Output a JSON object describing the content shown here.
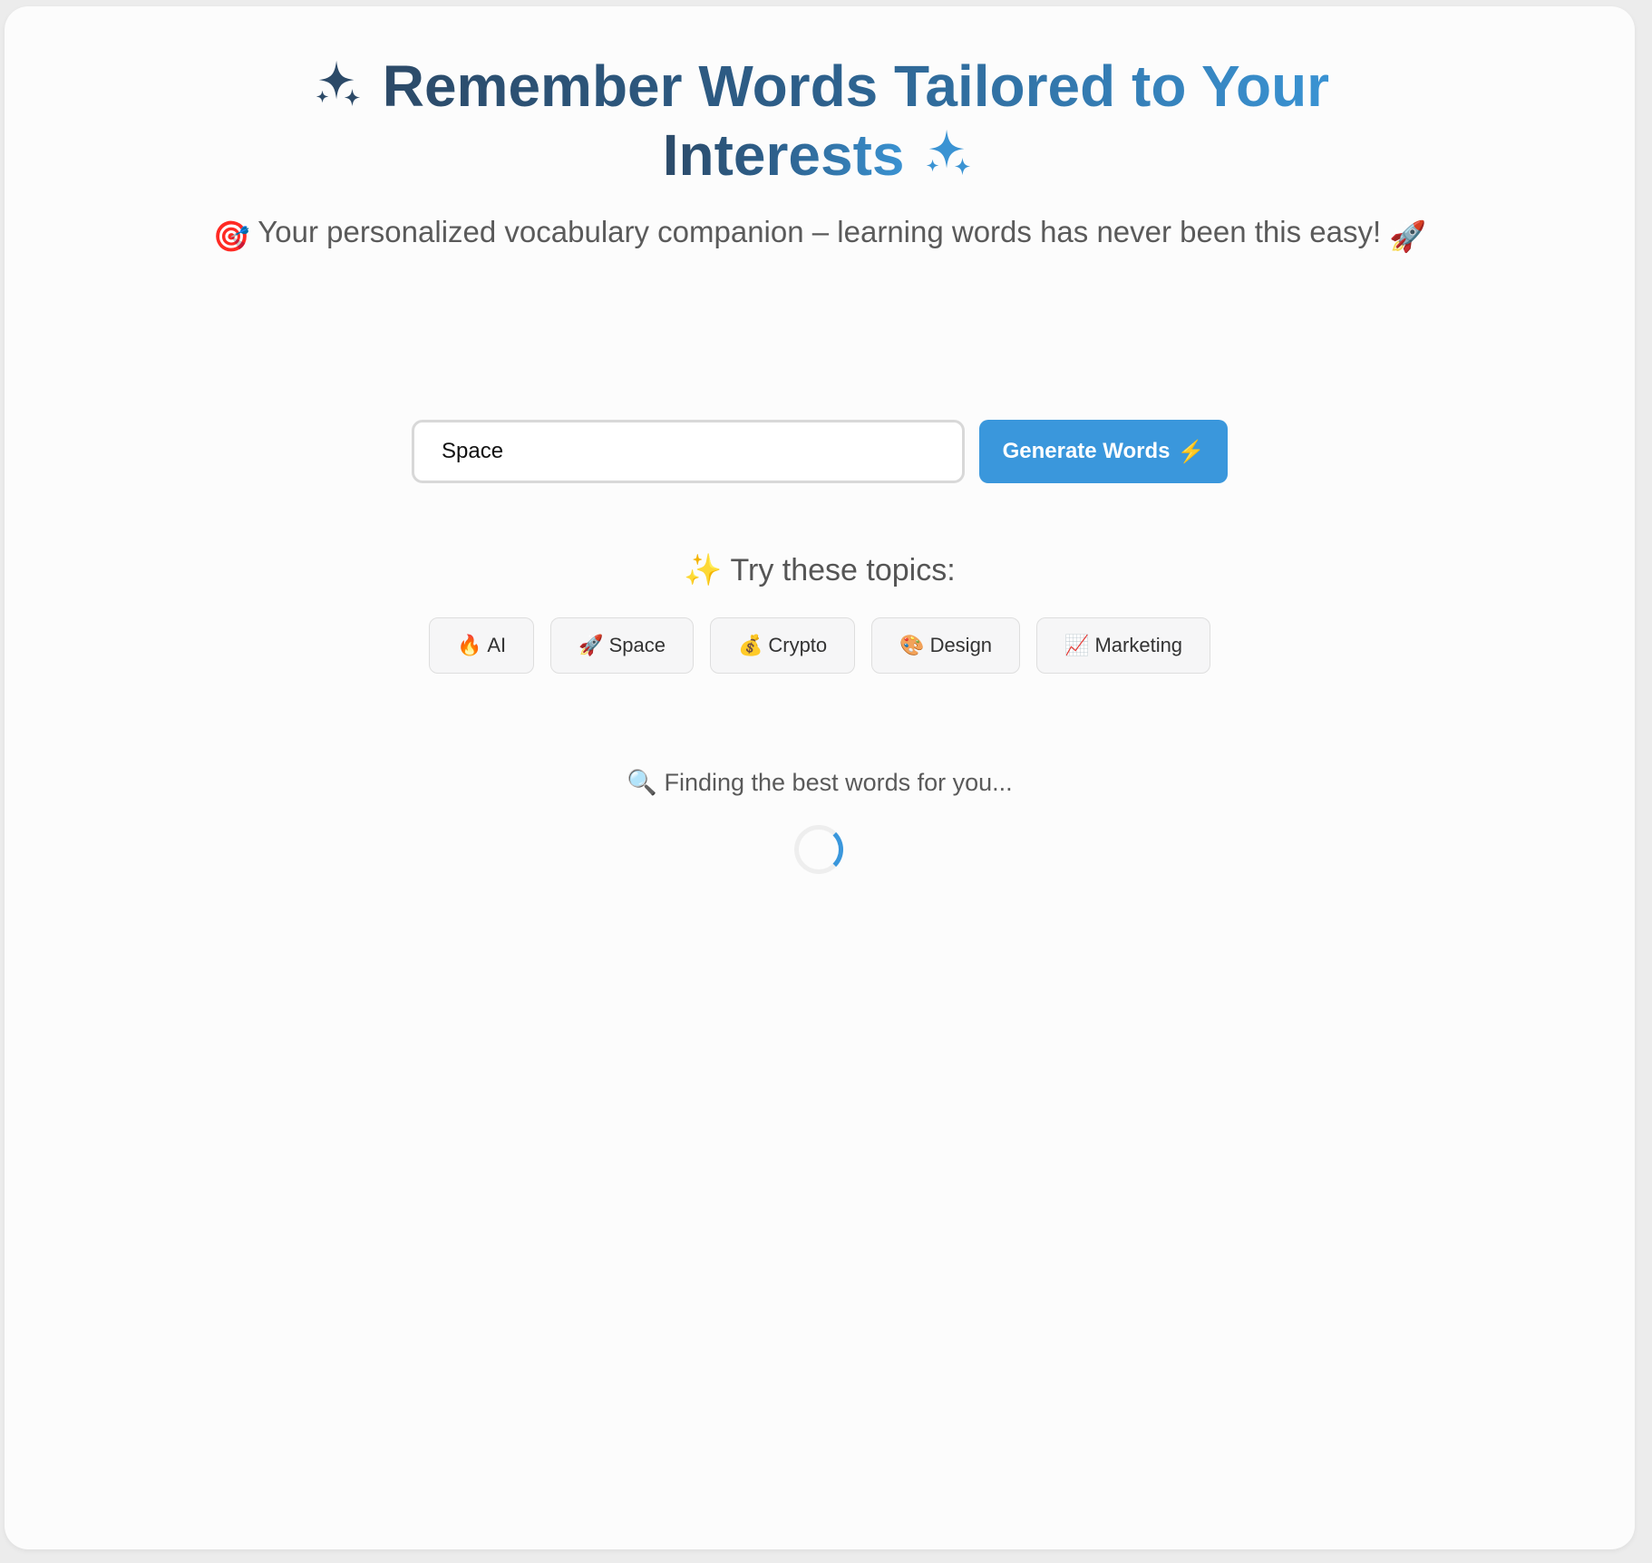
{
  "header": {
    "title_line1": "Remember Words Tailored to Your",
    "title_line2": "Interests",
    "sparkle_icon": "sparkles-icon",
    "subtitle": "Your personalized vocabulary companion – learning words has never been this easy!",
    "subtitle_lead_icon": "🎯",
    "subtitle_trail_icon": "🚀"
  },
  "search": {
    "value": "Space",
    "placeholder": "",
    "button_label": "Generate Words",
    "button_icon": "⚡"
  },
  "topics": {
    "label": "Try these topics:",
    "label_icon": "✨",
    "items": [
      {
        "icon": "🔥",
        "label": "AI"
      },
      {
        "icon": "🚀",
        "label": "Space"
      },
      {
        "icon": "💰",
        "label": "Crypto"
      },
      {
        "icon": "🎨",
        "label": "Design"
      },
      {
        "icon": "📈",
        "label": "Marketing"
      }
    ]
  },
  "status": {
    "icon": "🔍",
    "text": "Finding the best words for you..."
  },
  "colors": {
    "accent": "#3a97dc",
    "title_dark": "#2c4a68",
    "title_light": "#3a93d3"
  }
}
